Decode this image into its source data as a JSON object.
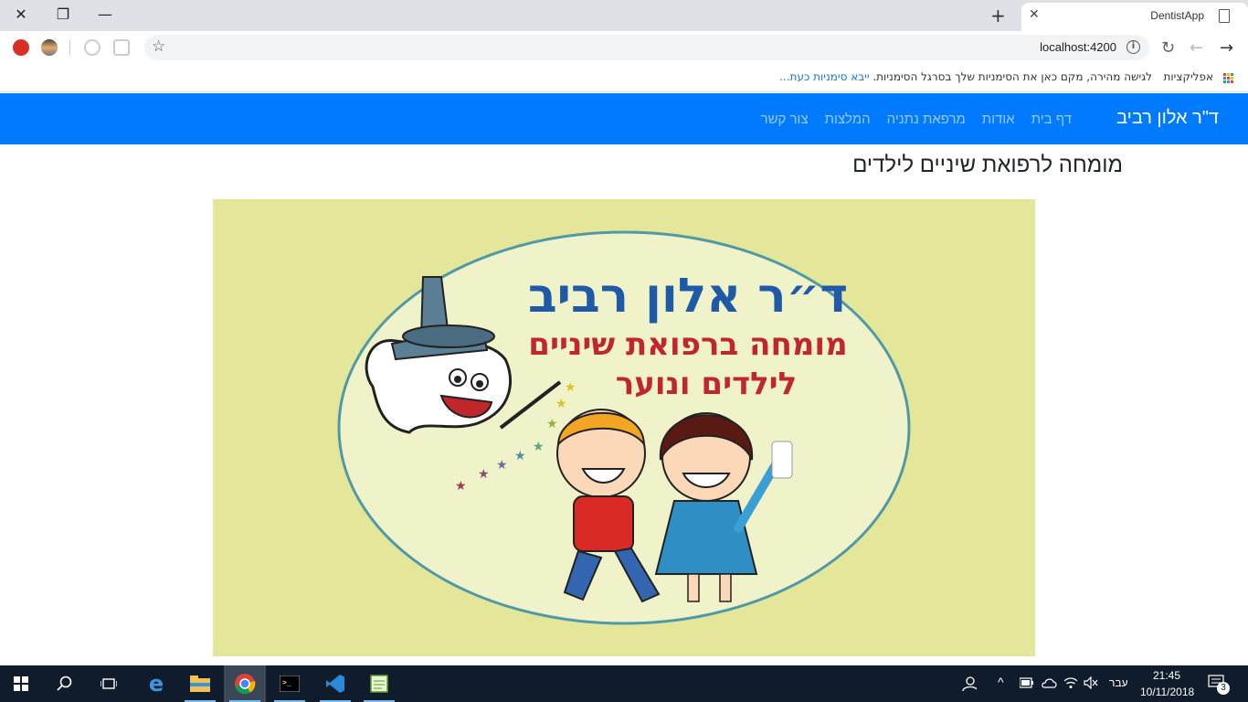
{
  "browser": {
    "tab_title": "DentistApp",
    "url": "localhost:4200"
  },
  "bookmarks": {
    "apps_label": "אפליקציות",
    "hint_text": "לגישה מהירה, מקם כאן את הסימניות שלך בסרגל הסימניות.",
    "import_link": "ייבא סימניות כעת..."
  },
  "navbar": {
    "brand": "ד\"ר אלון רביב",
    "links": [
      "דף בית",
      "אודות",
      "מרפאת נתניה",
      "המלצות",
      "צור קשר"
    ]
  },
  "page": {
    "heading": "מומחה לרפואת שיניים לילדים"
  },
  "hero_image": {
    "title": "ד״ר אלון רביב",
    "line1": "מומחה ברפואת שיניים",
    "line2": "לילדים ונוער"
  },
  "taskbar": {
    "lang": "עבר",
    "time": "21:45",
    "date": "10/11/2018",
    "notifications": "3"
  },
  "colors": {
    "navbar": "#007bff",
    "hero_bg": "#e4e69a",
    "taskbar": "#101c2c"
  }
}
